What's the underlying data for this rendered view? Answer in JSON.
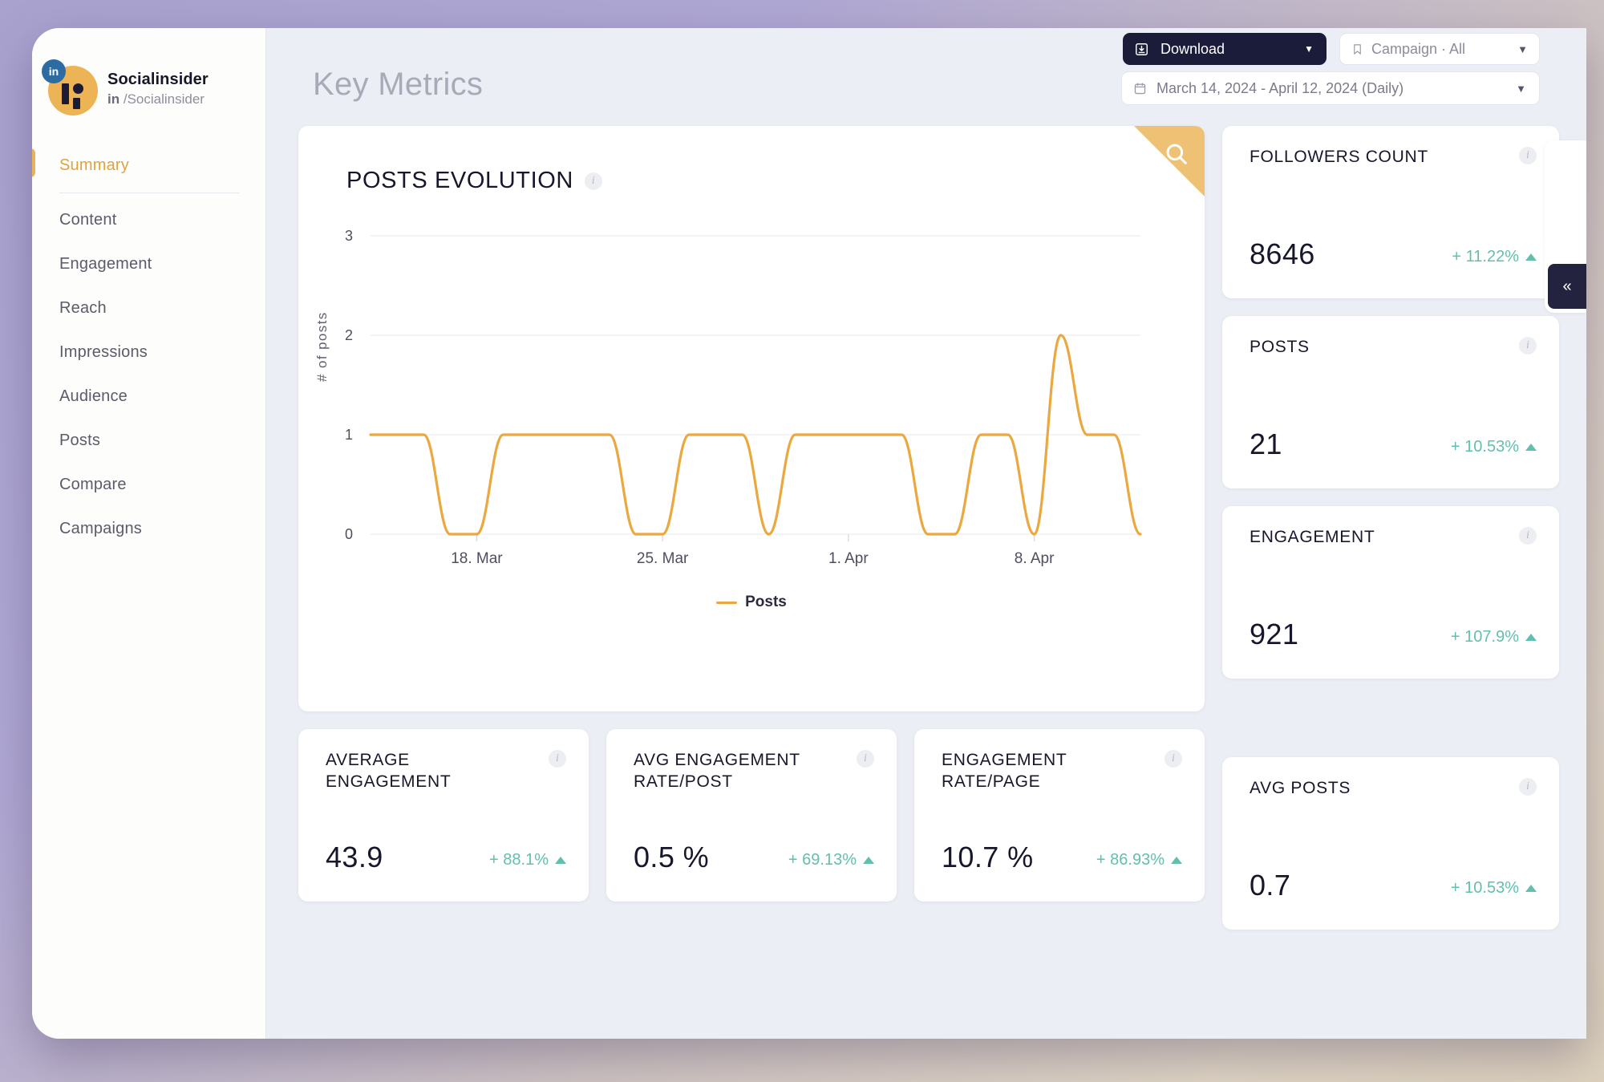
{
  "window": {
    "collapse_label": "«"
  },
  "sidebar": {
    "profile": {
      "name": "Socialinsider",
      "network_badge": "in",
      "network_prefix": "in",
      "handle": "/Socialinsider"
    },
    "items": [
      {
        "label": "Summary",
        "active": true
      },
      {
        "label": "Content",
        "active": false
      },
      {
        "label": "Engagement",
        "active": false
      },
      {
        "label": "Reach",
        "active": false
      },
      {
        "label": "Impressions",
        "active": false
      },
      {
        "label": "Audience",
        "active": false
      },
      {
        "label": "Posts",
        "active": false
      },
      {
        "label": "Compare",
        "active": false
      },
      {
        "label": "Campaigns",
        "active": false
      }
    ]
  },
  "header": {
    "title": "Key Metrics",
    "download_label": "Download",
    "download_caret": "▼",
    "campaign_label": "Campaign · All",
    "campaign_caret": "▼",
    "date_range_label": "March 14, 2024 - April 12, 2024 (Daily)",
    "date_caret": "▼"
  },
  "chart_card": {
    "title": "POSTS EVOLUTION",
    "info": "i"
  },
  "chart_data": {
    "type": "line",
    "title": "POSTS EVOLUTION",
    "xlabel": "",
    "ylabel": "# of posts",
    "ylim": [
      0,
      3
    ],
    "yticks": [
      0,
      1,
      2,
      3
    ],
    "xtick_labels": [
      "18. Mar",
      "25. Mar",
      "1. Apr",
      "8. Apr"
    ],
    "xtick_positions": [
      4,
      11,
      18,
      25
    ],
    "grid": true,
    "legend": {
      "position": "bottom",
      "entries": [
        "Posts"
      ]
    },
    "series": [
      {
        "name": "Posts",
        "color": "#eaa83f",
        "x": [
          "14. Mar",
          "15. Mar",
          "16. Mar",
          "17. Mar",
          "18. Mar",
          "19. Mar",
          "20. Mar",
          "21. Mar",
          "22. Mar",
          "23. Mar",
          "24. Mar",
          "25. Mar",
          "26. Mar",
          "27. Mar",
          "28. Mar",
          "29. Mar",
          "30. Mar",
          "31. Mar",
          "1. Apr",
          "2. Apr",
          "3. Apr",
          "4. Apr",
          "5. Apr",
          "6. Apr",
          "7. Apr",
          "8. Apr",
          "9. Apr",
          "10. Apr",
          "11. Apr",
          "12. Apr"
        ],
        "values": [
          1,
          1,
          1,
          0,
          0,
          1,
          1,
          1,
          1,
          1,
          0,
          0,
          1,
          1,
          1,
          0,
          1,
          1,
          1,
          1,
          1,
          0,
          0,
          1,
          1,
          0,
          2,
          1,
          1,
          0
        ]
      }
    ]
  },
  "metrics": {
    "right": [
      {
        "label": "FOLLOWERS COUNT",
        "value": "8646",
        "delta": "+ 11.22%",
        "trend": "up",
        "info": "i"
      },
      {
        "label": "POSTS",
        "value": "21",
        "delta": "+ 10.53%",
        "trend": "up",
        "info": "i"
      },
      {
        "label": "ENGAGEMENT",
        "value": "921",
        "delta": "+ 107.9%",
        "trend": "up",
        "info": "i"
      }
    ],
    "bottom": [
      {
        "label": "AVERAGE ENGAGEMENT",
        "value": "43.9",
        "delta": "+ 88.1%",
        "trend": "up",
        "info": "i"
      },
      {
        "label": "AVG ENGAGEMENT RATE/POST",
        "value": "0.5 %",
        "delta": "+ 69.13%",
        "trend": "up",
        "info": "i"
      },
      {
        "label": "ENGAGEMENT RATE/PAGE",
        "value": "10.7 %",
        "delta": "+ 86.93%",
        "trend": "up",
        "info": "i"
      },
      {
        "label": "AVG POSTS",
        "value": "0.7",
        "delta": "+ 10.53%",
        "trend": "up",
        "info": "i"
      }
    ]
  },
  "colors": {
    "accent_orange": "#eaa83f",
    "accent_teal": "#63bfad",
    "dark_navy": "#1b1b3a",
    "sidebar_active": "#e0a33f"
  }
}
